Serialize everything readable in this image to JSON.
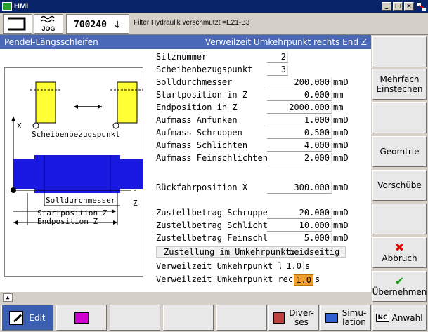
{
  "window": {
    "title": "HMI",
    "min": "_",
    "max": "□",
    "close": "×"
  },
  "header": {
    "mode": "JOG",
    "program": "700240",
    "message": "Filter Hydraulik verschmutzt =E21-B3"
  },
  "titlebar": {
    "left": "Pendel-Längsschleifen",
    "right": "Verweilzeit Umkehrpunkt rechts End Z"
  },
  "graphic": {
    "label_x": "X",
    "label_z": "Z",
    "ref_point": "Scheibenbezugspunkt",
    "diameter": "Solldurchmesser",
    "start": "Startposition Z",
    "end": "Endposition Z"
  },
  "params": [
    {
      "label": "Sitznummer",
      "value": "2",
      "unit": ""
    },
    {
      "label": "Scheibenbezugspunkt",
      "value": "3",
      "unit": ""
    },
    {
      "label": "Solldurchmesser",
      "value": "200.000",
      "unit": "mmD"
    },
    {
      "label": "Startposition in Z",
      "value": "0.000",
      "unit": "mm"
    },
    {
      "label": "Endposition in Z",
      "value": "2000.000",
      "unit": "mm"
    },
    {
      "label": "Aufmass Anfunken",
      "value": "1.000",
      "unit": "mmD"
    },
    {
      "label": "Aufmass Schruppen",
      "value": "0.500",
      "unit": "mmD"
    },
    {
      "label": "Aufmass Schlichten",
      "value": "4.000",
      "unit": "mmD"
    },
    {
      "label": "Aufmass Feinschlichten",
      "value": "2.000",
      "unit": "mmD"
    },
    {
      "label": "Rückfahrposition X",
      "value": "300.000",
      "unit": "mmD"
    },
    {
      "label": "Zustellbetrag Schruppen",
      "value": "20.000",
      "unit": "mmD"
    },
    {
      "label": "Zustellbetrag Schlichten",
      "value": "10.000",
      "unit": "mmD"
    },
    {
      "label": "Zustellbetrag Feinschlichte",
      "value": "5.000",
      "unit": "mmD"
    }
  ],
  "infeed": {
    "label": "Zustellung im Umkehrpunkt:",
    "value": "beidseitig"
  },
  "dwell_left": {
    "label": "Verweilzeit Umkehrpunkt links",
    "value": "1.0",
    "unit": "s"
  },
  "dwell_right": {
    "label": "Verweilzeit Umkehrpunkt rechts",
    "value": "1.0",
    "unit": "s"
  },
  "softkeys": {
    "sk1": "",
    "sk2a": "Mehrfach",
    "sk2b": "Einstechen",
    "sk3": "",
    "sk4": "Geomtrie",
    "sk5": "Vorschübe",
    "sk6": "",
    "abbruch": "Abbruch",
    "uebernehmen": "Übernehmen"
  },
  "bottom": {
    "edit": "Edit",
    "diverses_a": "Diver-",
    "diverses_b": "ses",
    "simulation_a": "Simu-",
    "simulation_b": "lation",
    "nc": "NC",
    "anwahl": "Anwahl"
  },
  "colors": {
    "accent": "#4a68b8",
    "highlight": "#f0a030",
    "yellow": "#ffff33",
    "blue": "#1818e0"
  }
}
